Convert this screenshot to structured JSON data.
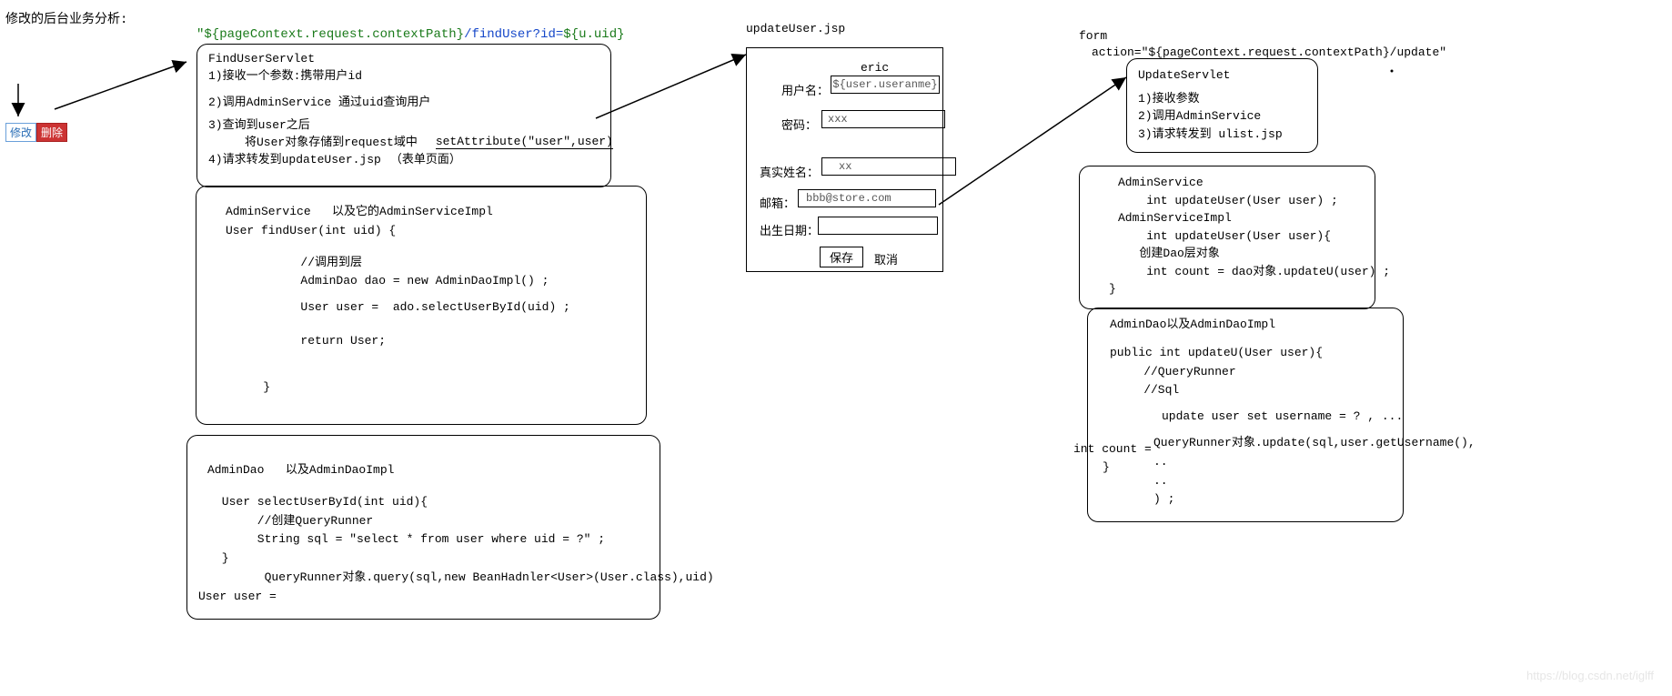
{
  "title": "修改的后台业务分析:",
  "link_line": {
    "quote_open": "\"",
    "ctx": "${pageContext.request.contextPath}",
    "path": "/findUser?id=",
    "uid": "${u.uid}"
  },
  "buttons": {
    "edit": "修改",
    "delete": "删除"
  },
  "servlet_box": {
    "title": "FindUserServlet",
    "l1": "1)接收一个参数:携带用户id",
    "l2": "2)调用AdminService 通过uid查询用户",
    "l3": "3)查询到user之后",
    "l3a": "将User对象存储到request域中",
    "l3b": "setAttribute(\"user\",user)",
    "l4": "4)请求转发到updateUser.jsp",
    "l4a": "（表单页面）"
  },
  "service_box": {
    "l1": "AdminService   以及它的AdminServiceImpl",
    "l2": "User findUser(int uid) {",
    "l3": "        //调用到层",
    "l4": "        AdminDao dao = new AdminDaoImpl() ;",
    "l5": "        User user =  ado.selectUserById(uid) ;",
    "l6": "        return User;",
    "l7": "    }"
  },
  "dao_box": {
    "l1": "AdminDao   以及AdminDaoImpl",
    "l2": " User selectUserById(int uid){",
    "l3": "      //创建QueryRunner",
    "l4": "      String sql = \"select * from user where uid = ?\" ;",
    "l5": " }",
    "l6": "       QueryRunner对象.query(sql,new BeanHadnler<User>(User.class),uid)",
    "l7": "User user = "
  },
  "jsp": {
    "title": "updateUser.jsp",
    "eric": "eric",
    "username_label": "用户名：",
    "username_val": "${user.useranme}",
    "pwd_label": "密码：",
    "pwd_val": "xxx",
    "realname_label": "真实姓名：",
    "realname_val": "xx",
    "email_label": "邮箱：",
    "email_val": "bbb@store.com",
    "birth_label": "出生日期：",
    "save": "保存",
    "cancel": "取消"
  },
  "form_label": "form",
  "form_action": "action=\"${pageContext.request.contextPath}/update\"",
  "update_servlet": {
    "title": "UpdateServlet",
    "l1": "1)接收参数",
    "l2": "2)调用AdminService",
    "l3": "3)请求转发到 ulist.jsp"
  },
  "update_service": {
    "l1": "AdminService",
    "l2": "    int updateUser(User user) ;",
    "l3": "AdminServiceImpl",
    "l4": "    int updateUser(User user){",
    "l5": "   创建Dao层对象",
    "l6": "    int count = dao对象.updateU(user) ;",
    "l7": "}"
  },
  "update_dao": {
    "l1": "AdminDao以及AdminDaoImpl",
    "l2": "public int updateU(User user){",
    "l3": "    //QueryRunner",
    "l4": "    //Sql",
    "l5": "     update user set username = ? , ...",
    "int_count": "int count = ",
    "l6": "QueryRunner对象.update(sql,user.getUsername(),",
    "l7": "..",
    "l8": "..",
    "l9": ") ;",
    "brace": "}"
  },
  "watermark": "https://blog.csdn.net/iglff"
}
